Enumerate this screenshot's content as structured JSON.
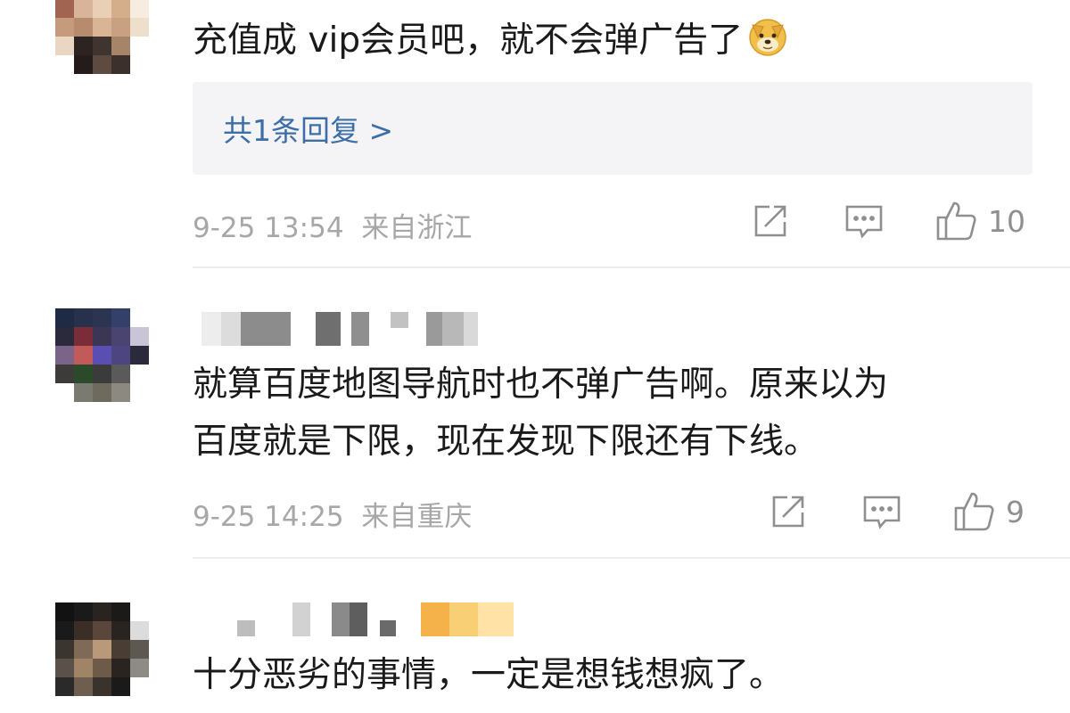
{
  "comments": [
    {
      "text": "充值成 vip会员吧，就不会弹广告了",
      "emoji": "doge-emoji",
      "replies_link": "共1条回复 >",
      "time": "9-25 13:54",
      "location": "来自浙江",
      "likes": "10"
    },
    {
      "line1": "就算百度地图导航时也不弹广告啊。原来以为",
      "line2": "百度就是下限，现在发现下限还有下线。",
      "time": "9-25 14:25",
      "location": "来自重庆",
      "likes": "9"
    },
    {
      "text": "十分恶劣的事情，一定是想钱想疯了。"
    }
  ],
  "icons": {
    "repost": "repost-icon",
    "comment": "comment-icon",
    "like": "thumbs-up-icon"
  },
  "colors": {
    "text": "#1a1a1a",
    "meta": "#a7a7a7",
    "link": "#3d6fa6",
    "reply_bg": "#f4f4f6",
    "icon": "#8f8f8f"
  }
}
